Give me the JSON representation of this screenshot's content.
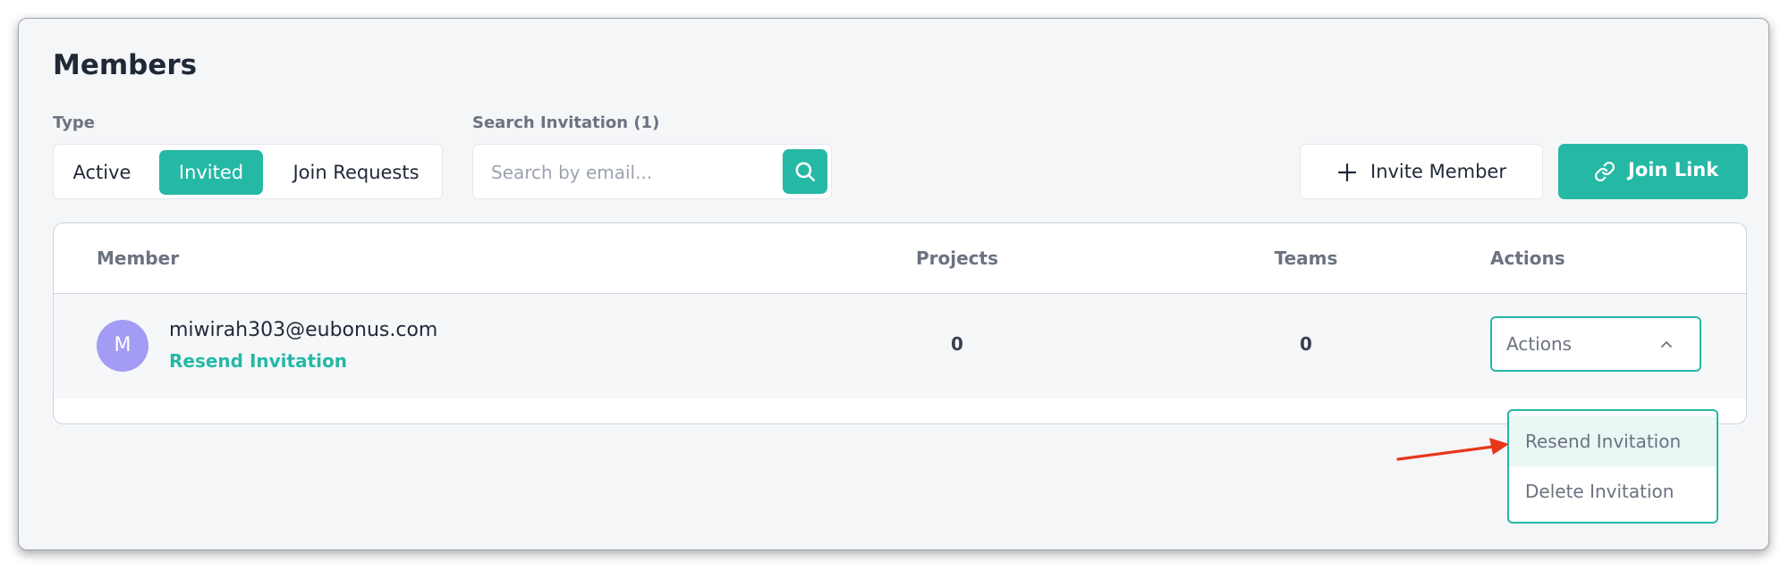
{
  "page": {
    "title": "Members"
  },
  "filters": {
    "type_label": "Type",
    "type_options": [
      "Active",
      "Invited",
      "Join Requests"
    ],
    "selected_type": "Invited",
    "search_label": "Search Invitation (1)",
    "search_placeholder": "Search by email...",
    "search_value": ""
  },
  "toolbar": {
    "invite_label": "Invite Member",
    "join_link_label": "Join Link"
  },
  "table": {
    "headers": {
      "member": "Member",
      "projects": "Projects",
      "teams": "Teams",
      "actions": "Actions"
    },
    "rows": [
      {
        "avatar_initial": "M",
        "email": "miwirah303@eubonus.com",
        "resend_link": "Resend Invitation",
        "projects": "0",
        "teams": "0",
        "actions_label": "Actions"
      }
    ]
  },
  "actions_menu": {
    "items": [
      "Resend Invitation",
      "Delete Invitation"
    ],
    "highlighted": "Resend Invitation"
  },
  "colors": {
    "accent": "#25b8a5",
    "avatar": "#a39cf4",
    "annotation_arrow": "#e8361b"
  },
  "icons": {
    "search": "search-icon",
    "invite": "plus-icon",
    "join": "link-icon",
    "dropdown": "chevron-up-icon"
  }
}
